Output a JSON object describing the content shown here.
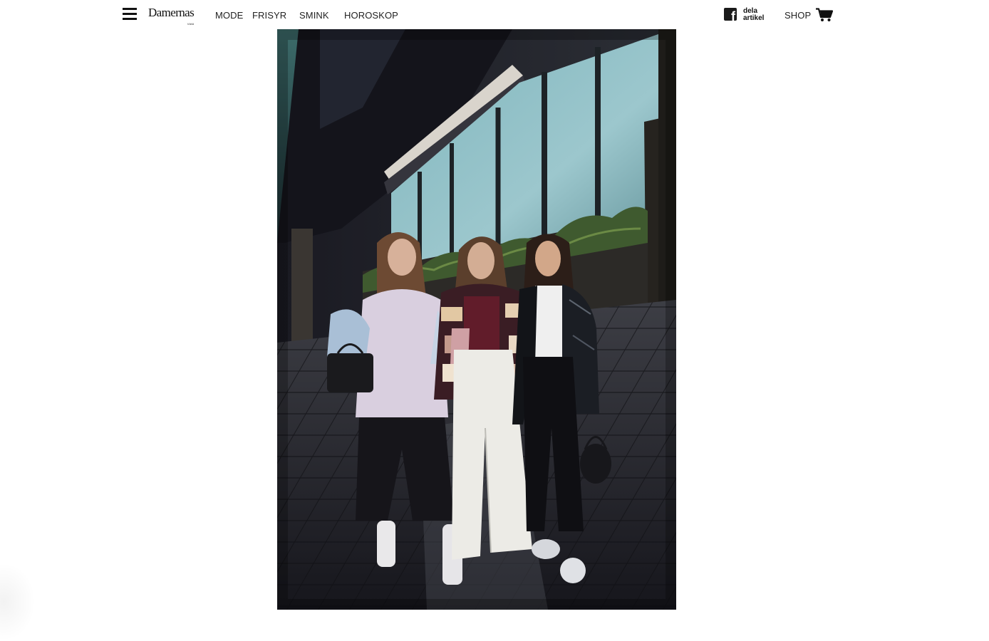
{
  "header": {
    "logo": "Damernas",
    "logo_sub": "Värld",
    "nav": [
      {
        "label": "MODE"
      },
      {
        "label": "FRISYR"
      },
      {
        "label": "SMINK"
      },
      {
        "label": "HOROSKOP"
      }
    ],
    "share_line1": "dela",
    "share_line2": "artikel",
    "shop_label": "SHOP"
  },
  "icons": {
    "menu": "hamburger-menu-icon",
    "share": "facebook-icon",
    "cart": "shopping-cart-icon"
  },
  "colors": {
    "text": "#111111",
    "background": "#ffffff"
  }
}
